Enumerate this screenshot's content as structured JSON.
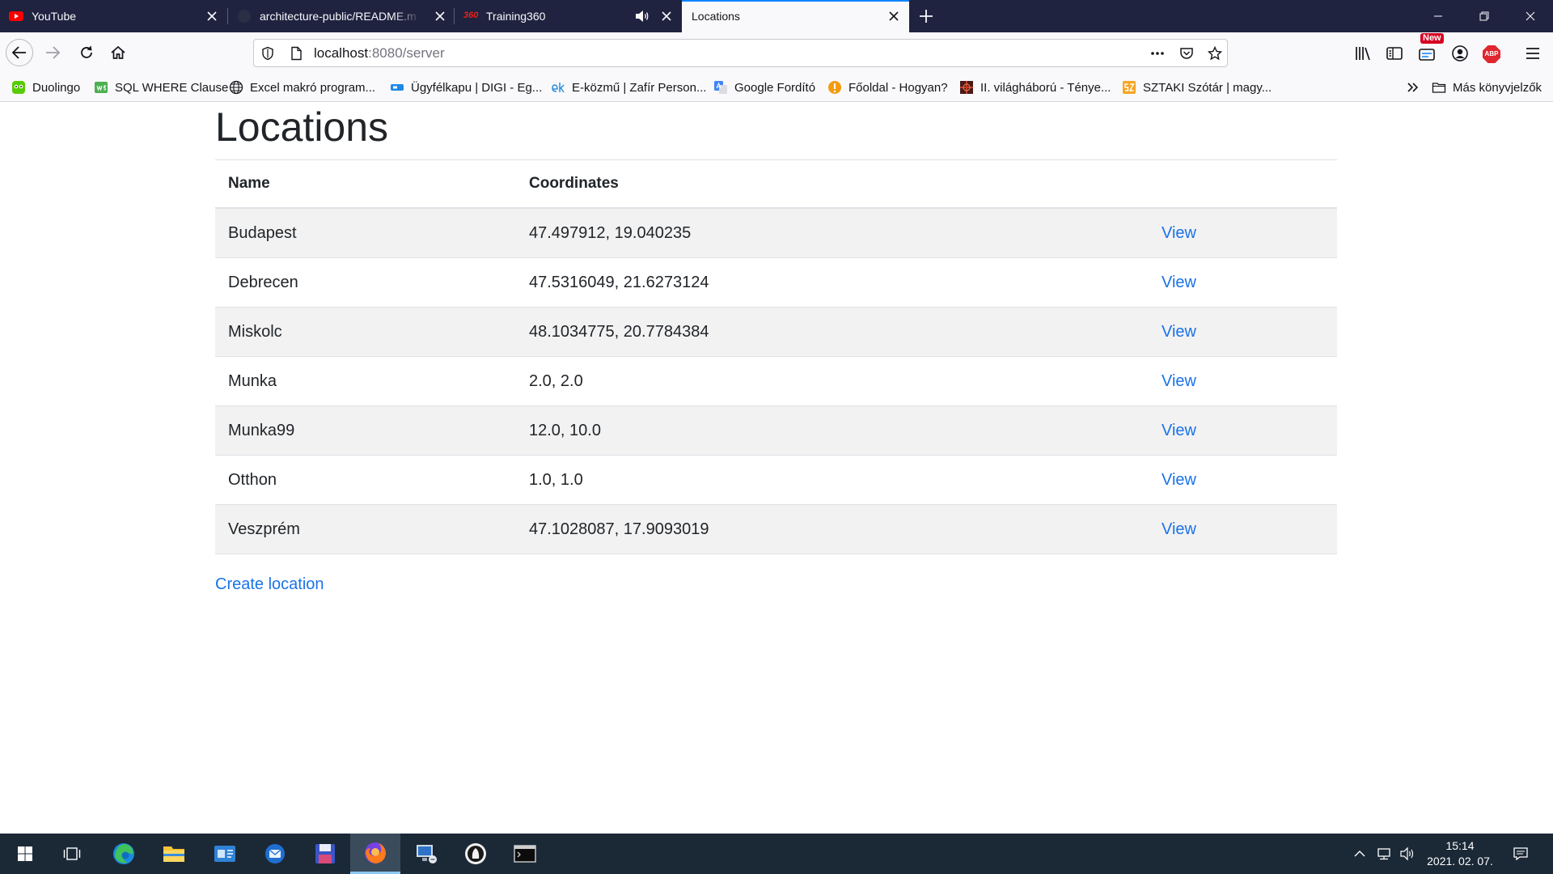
{
  "browser": {
    "tabs": [
      {
        "title": "YouTube",
        "icon": "youtube-icon"
      },
      {
        "title": "architecture-public/README.m",
        "icon": "github-icon"
      },
      {
        "title": "Training360",
        "icon": "training360-icon",
        "icon_text": "360",
        "audio_icon": "speaker-icon"
      },
      {
        "title": "Locations",
        "active": true
      }
    ],
    "new_tab_icon": "plus-icon",
    "window_controls": [
      "minimize-icon",
      "restore-icon",
      "close-icon"
    ],
    "nav": {
      "back": "back-arrow-icon",
      "forward": "forward-arrow-icon",
      "reload": "reload-icon",
      "home": "home-icon"
    },
    "url": {
      "host": "localhost",
      "rest": ":8080/server"
    },
    "url_icons": [
      "shield-icon",
      "page-icon",
      "more-dots-icon",
      "pocket-icon",
      "star-icon"
    ],
    "toolbar": {
      "icons": [
        "library-icon",
        "sidebar-icon",
        "whats-new-icon",
        "account-icon",
        "adblock-plus-icon",
        "hamburger-menu-icon"
      ],
      "new_badge": "New",
      "abp_label": "ABP"
    },
    "bookmarks": [
      {
        "label": "Duolingo",
        "icon": "duolingo-icon"
      },
      {
        "label": "SQL WHERE Clause",
        "icon": "w3schools-icon"
      },
      {
        "label": "Excel makró program...",
        "icon": "globe-icon"
      },
      {
        "label": "Ügyfélkapu | DIGI - Eg...",
        "icon": "ugyfelkapu-icon"
      },
      {
        "label": "E-közmű | Zafír Person...",
        "icon": "ekozmu-icon"
      },
      {
        "label": "Google Fordító",
        "icon": "google-translate-icon"
      },
      {
        "label": "Főoldal - Hogyan?",
        "icon": "hogyan-icon"
      },
      {
        "label": "II. világháború - Ténye...",
        "icon": "tenyek-icon"
      },
      {
        "label": "SZTAKI Szótár | magy...",
        "icon": "sztaki-icon"
      }
    ],
    "overflow_icon": "chevron-double-right-icon",
    "other_bookmarks": {
      "label": "Más könyvjelzők",
      "icon": "folder-icon"
    }
  },
  "page": {
    "title": "Locations",
    "columns": {
      "name": "Name",
      "coordinates": "Coordinates"
    },
    "rows": [
      {
        "name": "Budapest",
        "coordinates": "47.497912, 19.040235"
      },
      {
        "name": "Debrecen",
        "coordinates": "47.5316049, 21.6273124"
      },
      {
        "name": "Miskolc",
        "coordinates": "48.1034775, 20.7784384"
      },
      {
        "name": "Munka",
        "coordinates": "2.0, 2.0"
      },
      {
        "name": "Munka99",
        "coordinates": "12.0, 10.0"
      },
      {
        "name": "Otthon",
        "coordinates": "1.0, 1.0"
      },
      {
        "name": "Veszprém",
        "coordinates": "47.1028087, 17.9093019"
      }
    ],
    "view_label": "View",
    "create_label": "Create location"
  },
  "taskbar": {
    "apps": [
      "windows-start-icon",
      "task-view-icon",
      "edge-icon",
      "file-explorer-icon",
      "app-card-icon",
      "thunderbird-icon",
      "floppy-app-icon",
      "firefox-icon",
      "computer-app-icon",
      "dark-round-app-icon",
      "terminal-icon"
    ],
    "tray": [
      "chevron-up-icon",
      "network-icon",
      "speaker-icon",
      "notification-icon"
    ],
    "time": "15:14",
    "date": "2021. 02. 07."
  },
  "colors": {
    "tab_bar": "#1f2340",
    "active_tab_accent": "#0a84ff",
    "link": "#1a73e8",
    "stripe": "#f2f2f2",
    "taskbar": "#1b2937"
  }
}
